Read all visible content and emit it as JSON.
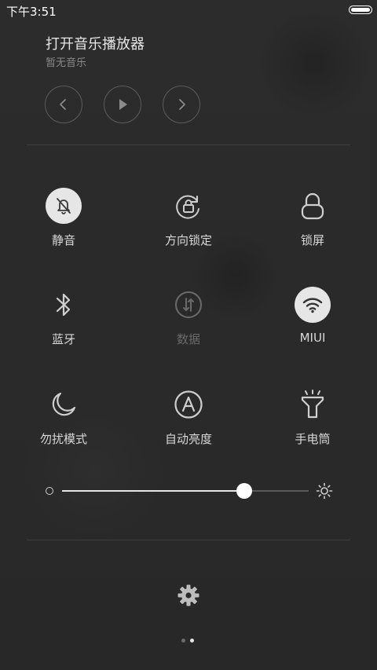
{
  "status_bar": {
    "time": "下午3:51",
    "battery_level": 1.0
  },
  "music_player": {
    "title": "打开音乐播放器",
    "subtitle": "暂无音乐",
    "controls": {
      "previous_icon": "chevron-left-icon",
      "play_icon": "play-icon",
      "next_icon": "chevron-right-icon"
    }
  },
  "toggles": [
    {
      "label": "静音",
      "icon": "bell-off-icon",
      "active": true
    },
    {
      "label": "方向锁定",
      "icon": "rotation-lock-icon",
      "active": false
    },
    {
      "label": "锁屏",
      "icon": "lock-icon",
      "active": false
    },
    {
      "label": "蓝牙",
      "icon": "bluetooth-icon",
      "active": false
    },
    {
      "label": "数据",
      "icon": "mobile-data-icon",
      "active": false,
      "disabled": true
    },
    {
      "label": "MIUI",
      "icon": "wifi-icon",
      "active": true
    },
    {
      "label": "勿扰模式",
      "icon": "moon-icon",
      "active": false
    },
    {
      "label": "自动亮度",
      "icon": "auto-brightness-icon",
      "active": false
    },
    {
      "label": "手电筒",
      "icon": "flashlight-icon",
      "active": false
    }
  ],
  "brightness": {
    "level": 0.74,
    "min_icon": "circle-small-icon",
    "max_icon": "sun-icon"
  },
  "settings": {
    "icon": "gear-icon"
  },
  "pager": {
    "count": 2,
    "current": 1
  },
  "colors": {
    "background": "#2a2a2a",
    "active_tile": "#e6e6e6",
    "text": "#d8d8d8",
    "dim_text": "#6a6a6a"
  }
}
